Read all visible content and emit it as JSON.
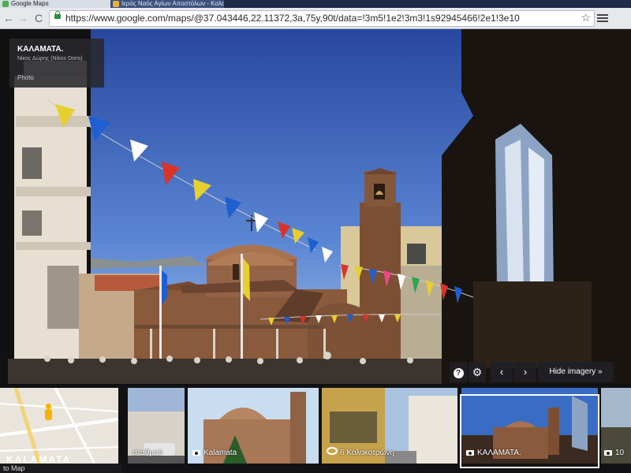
{
  "browser": {
    "tabs": [
      {
        "label": "Google Maps",
        "active": true
      },
      {
        "label": "Ιερός Ναός Αγίων Αποστόλων - Καλαμάτα",
        "active": false
      }
    ],
    "address": "https://www.google.com/maps/@37.043446,22.11372,3a,75y,90t/data=!3m5!1e2!3m3!1s92945466!2e1!3e10"
  },
  "info_card": {
    "place": "ΚΑΛΑΜΑΤΑ.",
    "author": "Νίκος Δώρης (Nikos Doris)",
    "type": "Photo"
  },
  "controls": {
    "help": "?",
    "settings": "⚙",
    "prev": "‹",
    "next": "›",
    "hide_imagery": "Hide imagery »"
  },
  "filmstrip": {
    "map_label": "KALAMATA",
    "back_to_map": "to Map",
    "thumbs": [
      {
        "label": "σταθμού",
        "icon": false
      },
      {
        "label": "Kalamata",
        "icon": true
      },
      {
        "label": "6 Κολοκοτρώνη",
        "icon": false
      },
      {
        "label": "ΚΑΛΑΜΑΤΑ.",
        "icon": true,
        "selected": true
      },
      {
        "label": "10",
        "icon": true
      }
    ]
  },
  "colors": {
    "sky_top": "#2a4fb0",
    "sky_bottom": "#8fb3e6",
    "brick": "#8a5a3c",
    "dome_roof": "#a8734f",
    "flag_blue": "#1e5fd1"
  },
  "icons": [
    "back-icon",
    "forward-icon",
    "reload-icon",
    "lock-icon",
    "star-icon",
    "menu-icon",
    "help-icon",
    "settings-icon",
    "chevron-left-icon",
    "chevron-right-icon",
    "camera-icon",
    "pegman-icon"
  ]
}
